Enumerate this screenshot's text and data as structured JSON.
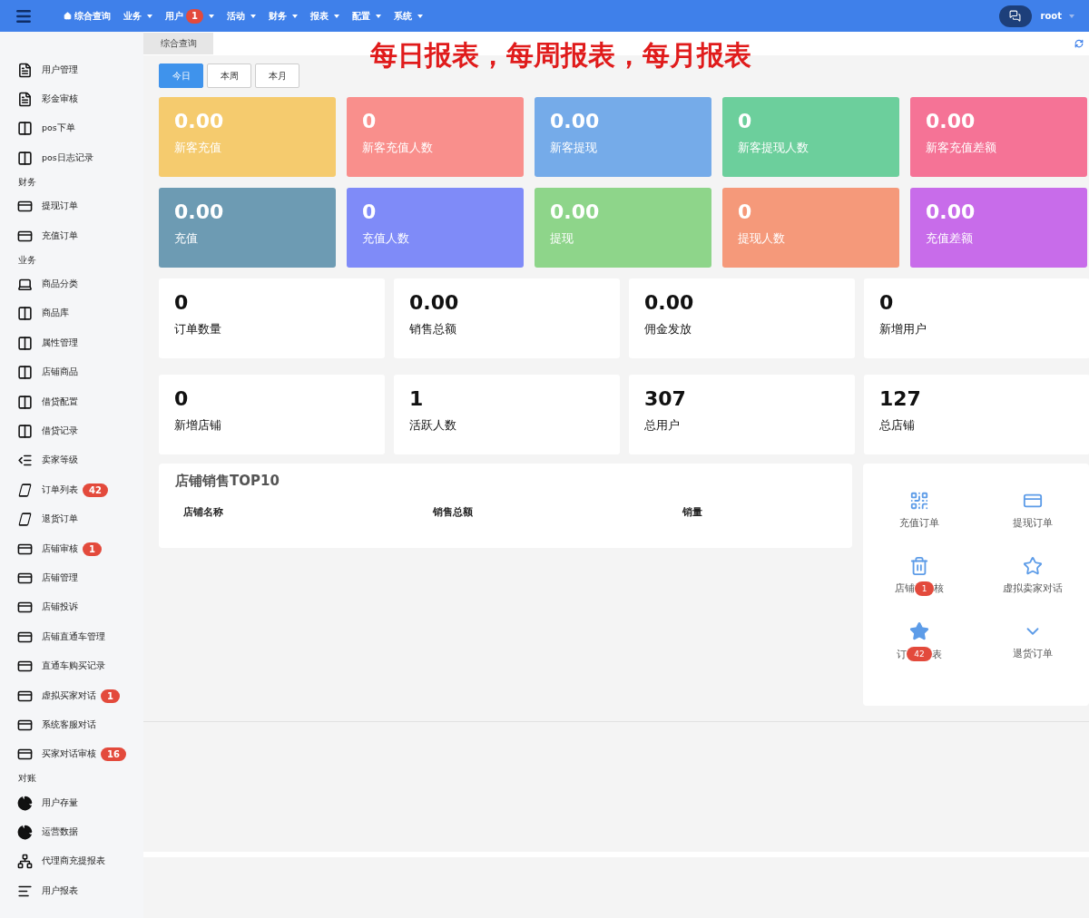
{
  "topbar": {
    "menu": [
      {
        "label": "综合查询",
        "kind": "home"
      },
      {
        "label": "业务",
        "kind": "menu"
      },
      {
        "label": "用户",
        "kind": "menu",
        "badge": "1"
      },
      {
        "label": "活动",
        "kind": "menu"
      },
      {
        "label": "财务",
        "kind": "menu"
      },
      {
        "label": "报表",
        "kind": "menu"
      },
      {
        "label": "配置",
        "kind": "menu"
      },
      {
        "label": "系统",
        "kind": "menu"
      }
    ],
    "user": "root"
  },
  "sidebar": [
    {
      "kind": "item",
      "label": "用户管理"
    },
    {
      "kind": "item",
      "label": "彩金审核"
    },
    {
      "kind": "item",
      "label": "pos下单"
    },
    {
      "kind": "item",
      "label": "pos日志记录"
    },
    {
      "kind": "section",
      "label": "财务"
    },
    {
      "kind": "item",
      "label": "提现订单"
    },
    {
      "kind": "item",
      "label": "充值订单"
    },
    {
      "kind": "section",
      "label": "业务"
    },
    {
      "kind": "item",
      "label": "商品分类"
    },
    {
      "kind": "item",
      "label": "商品库"
    },
    {
      "kind": "item",
      "label": "属性管理"
    },
    {
      "kind": "item",
      "label": "店铺商品"
    },
    {
      "kind": "item",
      "label": "借贷配置"
    },
    {
      "kind": "item",
      "label": "借贷记录"
    },
    {
      "kind": "item",
      "label": "卖家等级"
    },
    {
      "kind": "item",
      "label": "订单列表",
      "badge": "42"
    },
    {
      "kind": "item",
      "label": "退货订单"
    },
    {
      "kind": "item",
      "label": "店铺审核",
      "badge": "1"
    },
    {
      "kind": "item",
      "label": "店铺管理"
    },
    {
      "kind": "item",
      "label": "店铺投诉"
    },
    {
      "kind": "item",
      "label": "店铺直通车管理"
    },
    {
      "kind": "item",
      "label": "直通车购买记录"
    },
    {
      "kind": "item",
      "label": "虚拟买家对话",
      "badge": "1"
    },
    {
      "kind": "item",
      "label": "系统客服对话"
    },
    {
      "kind": "item",
      "label": "买家对话审核",
      "badge": "16"
    },
    {
      "kind": "section",
      "label": "对账"
    },
    {
      "kind": "item",
      "label": "用户存量"
    },
    {
      "kind": "item",
      "label": "运营数据"
    },
    {
      "kind": "item",
      "label": "代理商充提报表"
    },
    {
      "kind": "item",
      "label": "用户报表"
    }
  ],
  "page_tab": "综合查询",
  "headline": "每日报表，每周报表，每月报表",
  "period_tabs": [
    {
      "label": "今日",
      "selected": true
    },
    {
      "label": "本周",
      "selected": false
    },
    {
      "label": "本月",
      "selected": false
    }
  ],
  "color_cards": [
    {
      "value": "0.00",
      "label": "新客充值",
      "color": "#f5cb6e"
    },
    {
      "value": "0",
      "label": "新客充值人数",
      "color": "#f98f8c"
    },
    {
      "value": "0.00",
      "label": "新客提现",
      "color": "#75abe9"
    },
    {
      "value": "0",
      "label": "新客提现人数",
      "color": "#6ccf9c"
    },
    {
      "value": "0.00",
      "label": "新客充值差额",
      "color": "#f57396"
    },
    {
      "value": "0.00",
      "label": "充值",
      "color": "#6d9bb3"
    },
    {
      "value": "0",
      "label": "充值人数",
      "color": "#7f8bf8"
    },
    {
      "value": "0.00",
      "label": "提现",
      "color": "#8ed58a"
    },
    {
      "value": "0",
      "label": "提现人数",
      "color": "#f5997a"
    },
    {
      "value": "0.00",
      "label": "充值差额",
      "color": "#c86cea"
    }
  ],
  "stat_cards": [
    {
      "value": "0",
      "label": "订单数量"
    },
    {
      "value": "0.00",
      "label": "销售总额"
    },
    {
      "value": "0.00",
      "label": "佣金发放"
    },
    {
      "value": "0",
      "label": "新增用户"
    },
    {
      "value": "0",
      "label": "新增店铺"
    },
    {
      "value": "1",
      "label": "活跃人数"
    },
    {
      "value": "307",
      "label": "总用户"
    },
    {
      "value": "127",
      "label": "总店铺"
    }
  ],
  "top10": {
    "title": "店铺销售TOP10",
    "columns": [
      "店铺名称",
      "销售总额",
      "销量"
    ]
  },
  "shortcuts": [
    {
      "parts": [
        "充值订单"
      ]
    },
    {
      "parts": [
        "提现订单"
      ]
    },
    {
      "parts": [
        "店铺",
        "核"
      ],
      "badge": "1"
    },
    {
      "parts": [
        "虚拟卖家对话"
      ]
    },
    {
      "parts": [
        "订",
        "表"
      ],
      "badge": "42"
    },
    {
      "parts": [
        "退货订单"
      ]
    }
  ]
}
